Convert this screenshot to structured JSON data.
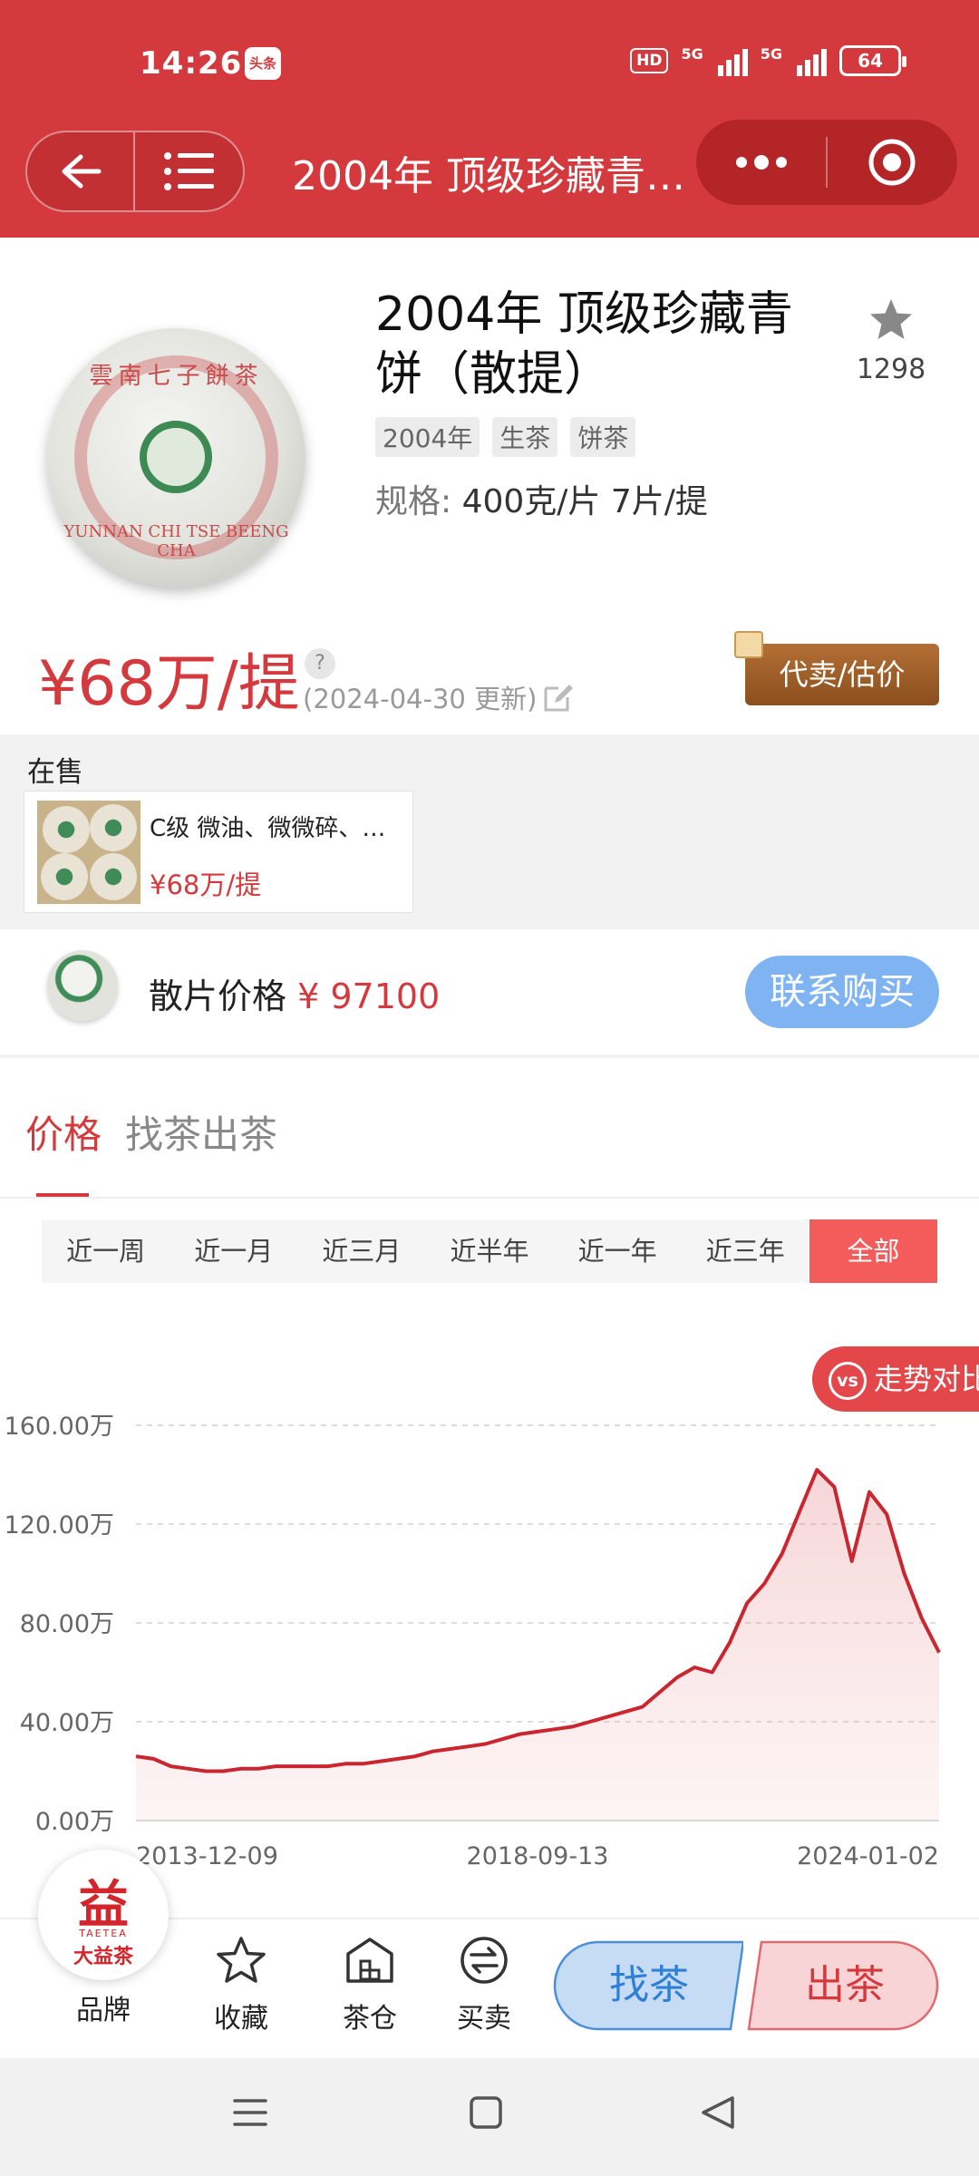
{
  "status": {
    "time": "14:26",
    "app_badge": "头条",
    "hd": "HD",
    "net1": "5G",
    "net2": "5G",
    "battery": "64"
  },
  "nav": {
    "title": "2004年 顶级珍藏青…"
  },
  "product": {
    "title": "2004年 顶级珍藏青饼（散提）",
    "favorite_count": "1298",
    "tags": [
      "2004年",
      "生茶",
      "饼茶"
    ],
    "spec_label": "规格:",
    "spec_value": "400克/片 7片/提",
    "price": "¥68万/提",
    "help": "?",
    "updated": "(2024-04-30 更新)",
    "sell_button": "代卖/估价",
    "cake_text": "雲南七子餅茶",
    "cake_bottom": "YUNNAN CHI TSE BEENG CHA"
  },
  "on_sale": {
    "label": "在售",
    "item": {
      "desc": "C级 微油、微微碎、…",
      "price": "¥68万/提"
    }
  },
  "loose": {
    "label": "散片价格",
    "value": "¥ 97100",
    "button": "联系购买"
  },
  "tabs": [
    {
      "label": "价格",
      "active": true
    },
    {
      "label": "找茶出茶",
      "active": false
    }
  ],
  "ranges": [
    "近一周",
    "近一月",
    "近三月",
    "近半年",
    "近一年",
    "近三年",
    "全部"
  ],
  "active_range": "全部",
  "compare_button": {
    "icon": "vs",
    "label": "走势对比"
  },
  "chart_data": {
    "type": "area",
    "x_tick_labels": [
      "2013-12-09",
      "2018-09-13",
      "2024-01-02"
    ],
    "y_tick_labels": [
      "0.00万",
      "40.00万",
      "80.00万",
      "120.00万",
      "160.00万"
    ],
    "ylim": [
      0,
      160
    ],
    "x": [
      "2013-11",
      "2014-03",
      "2014-06",
      "2014-09",
      "2014-12",
      "2015-03",
      "2015-06",
      "2015-09",
      "2015-12",
      "2016-03",
      "2016-06",
      "2016-09",
      "2016-12",
      "2017-03",
      "2017-06",
      "2017-09",
      "2017-12",
      "2018-03",
      "2018-06",
      "2018-09",
      "2018-12",
      "2019-03",
      "2019-06",
      "2019-09",
      "2019-12",
      "2020-03",
      "2020-06",
      "2020-09",
      "2020-12",
      "2021-03",
      "2021-06",
      "2021-09",
      "2021-12",
      "2022-03",
      "2022-06",
      "2022-09",
      "2022-12",
      "2023-03",
      "2023-06",
      "2023-09",
      "2023-12",
      "2024-03",
      "2024-04"
    ],
    "series": [
      {
        "values": [
          26,
          25,
          22,
          21,
          20,
          20,
          21,
          21,
          22,
          22,
          22,
          22,
          23,
          23,
          24,
          25,
          26,
          28,
          29,
          30,
          31,
          33,
          35,
          36,
          37,
          38,
          40,
          42,
          44,
          46,
          52,
          58,
          62,
          60,
          72,
          88,
          96,
          108,
          125,
          142,
          135,
          105,
          133,
          124,
          100,
          82,
          68
        ]
      }
    ],
    "color": "#c9262f",
    "grid": true
  },
  "bottom": {
    "brand": "品牌",
    "brand_logo_char": "益",
    "brand_logo_en": "TAETEA",
    "brand_logo_cn": "大益茶",
    "favorite": "收藏",
    "warehouse": "茶仓",
    "trade": "买卖",
    "find": "找茶",
    "sell": "出茶"
  }
}
